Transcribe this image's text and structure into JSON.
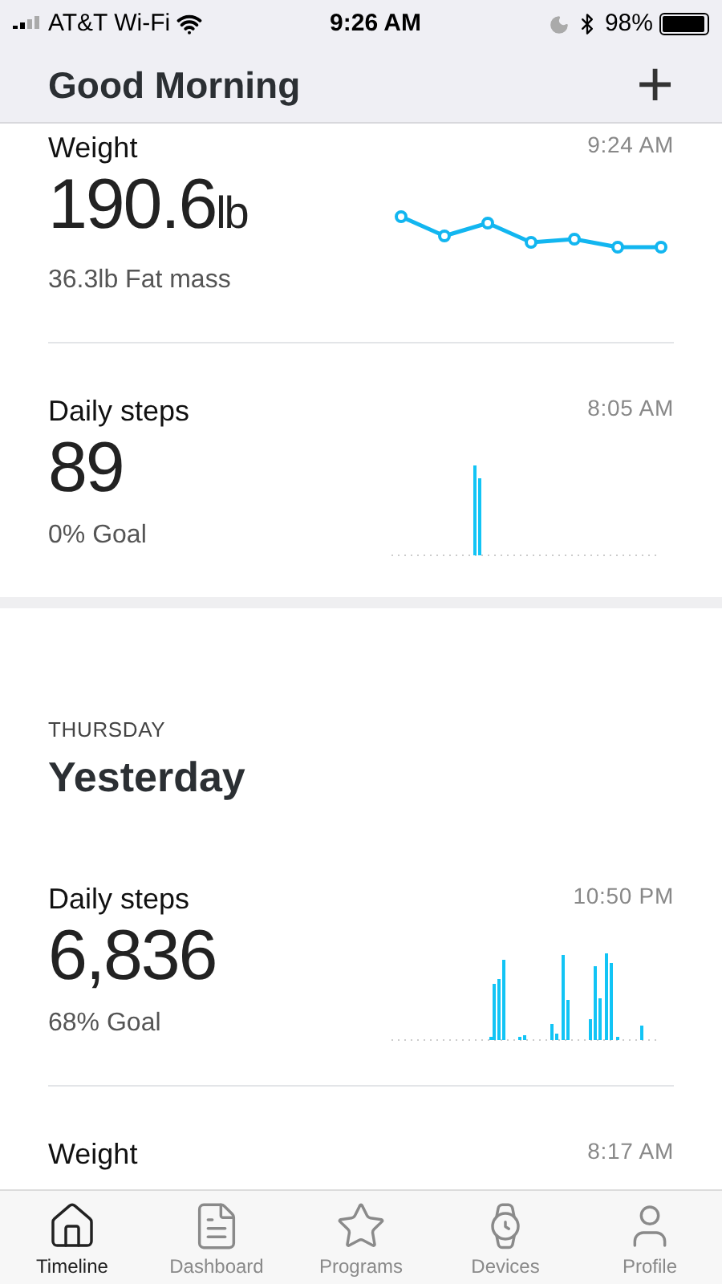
{
  "status_bar": {
    "carrier": "AT&T Wi-Fi",
    "time": "9:26 AM",
    "battery": "98%"
  },
  "header": {
    "title": "Good Morning",
    "add": "+"
  },
  "today": [
    {
      "kind": "weight",
      "title": "Weight",
      "time": "9:24 AM",
      "value": "190.6",
      "unit": "lb",
      "detail": "36.3lb Fat mass"
    },
    {
      "kind": "steps",
      "title": "Daily steps",
      "time": "8:05 AM",
      "value": "89",
      "detail": "0% Goal"
    }
  ],
  "yesterday": {
    "day": "THURSDAY",
    "title": "Yesterday",
    "cards": [
      {
        "kind": "steps",
        "title": "Daily steps",
        "time": "10:50 PM",
        "value": "6,836",
        "detail": "68% Goal"
      },
      {
        "kind": "weight",
        "title": "Weight",
        "time": "8:17 AM"
      }
    ]
  },
  "tabs": [
    {
      "label": "Timeline",
      "selected": true
    },
    {
      "label": "Dashboard",
      "selected": false
    },
    {
      "label": "Programs",
      "selected": false
    },
    {
      "label": "Devices",
      "selected": false
    },
    {
      "label": "Profile",
      "selected": false
    }
  ]
}
